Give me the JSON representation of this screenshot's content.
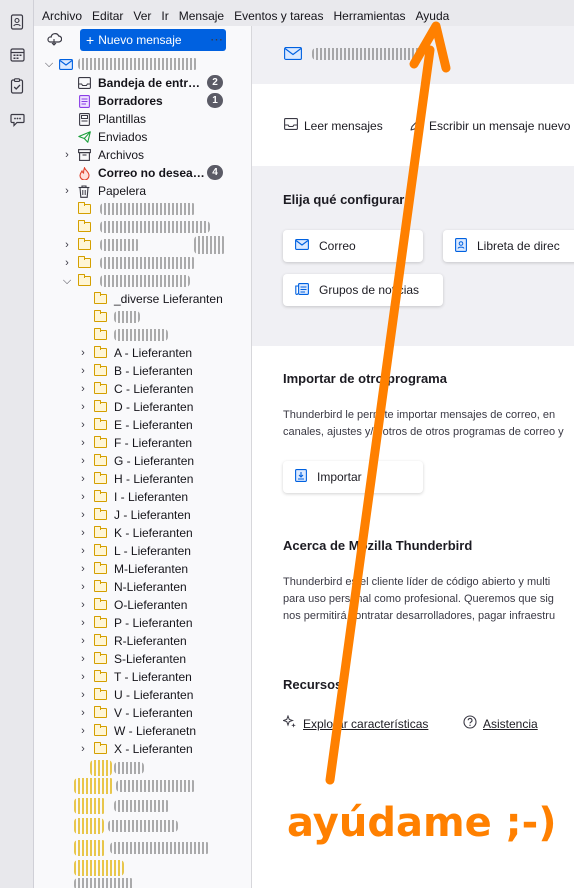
{
  "menubar": {
    "items": [
      "Archivo",
      "Editar",
      "Ver",
      "Ir",
      "Mensaje",
      "Eventos y tareas",
      "Herramientas",
      "Ayuda"
    ]
  },
  "spaces": {
    "icons": [
      "address-book-icon",
      "calendar-icon",
      "tasks-icon",
      "chat-icon"
    ]
  },
  "folderpane": {
    "new_message": "Nuevo mensaje",
    "more": "⋯",
    "account": {
      "inbox": "Bandeja de entr…",
      "inbox_count": "2",
      "drafts": "Borradores",
      "drafts_count": "1",
      "templates": "Plantillas",
      "sent": "Enviados",
      "archives": "Archivos",
      "junk": "Correo no desea…",
      "junk_count": "4",
      "trash": "Papelera"
    },
    "subfolders": [
      "_diverse Lieferanten",
      "A - Lieferanten",
      "B - Lieferanten",
      "C - Lieferanten",
      "D - Lieferanten",
      "E - Lieferanten",
      "F - Lieferanten",
      "G - Lieferanten",
      "H - Lieferanten",
      "I - Lieferanten",
      "J - Lieferanten",
      "K - Lieferanten",
      "L - Lieferanten",
      "M-Lieferanten",
      "N-Lieferanten",
      "O-Lieferanten",
      "P - Lieferanten",
      "R-Lieferanten",
      "S-Lieferanten",
      "T - Lieferanten",
      "U - Lieferanten",
      "V - Lieferanten",
      "W - Lieferanetn",
      "X - Lieferanten"
    ]
  },
  "main": {
    "actions": {
      "read": "Leer mensajes",
      "write": "Escribir un mensaje nuevo"
    },
    "configure": {
      "title": "Elija qué configurar",
      "mail": "Correo",
      "address_book": "Libreta de direc",
      "newsgroups": "Grupos de noticias"
    },
    "import": {
      "title": "Importar de otro programa",
      "text_line1": "Thunderbird le permite importar mensajes de correo, en",
      "text_line2": "canales, ajustes y/u otros de otros programas de correo y",
      "button": "Importar"
    },
    "about": {
      "title": "Acerca de Mozilla Thunderbird",
      "line1": "Thunderbird es el cliente líder de código abierto y multi",
      "line2": "para uso personal como profesional. Queremos que sig",
      "line3": "nos permitirá contratar desarrolladores, pagar infraestru"
    },
    "resources": {
      "title": "Recursos",
      "explore": "Explorar características",
      "support": "Asistencia"
    }
  },
  "annotation": {
    "text": "ayúdame ;-)",
    "color": "#ff8000"
  }
}
